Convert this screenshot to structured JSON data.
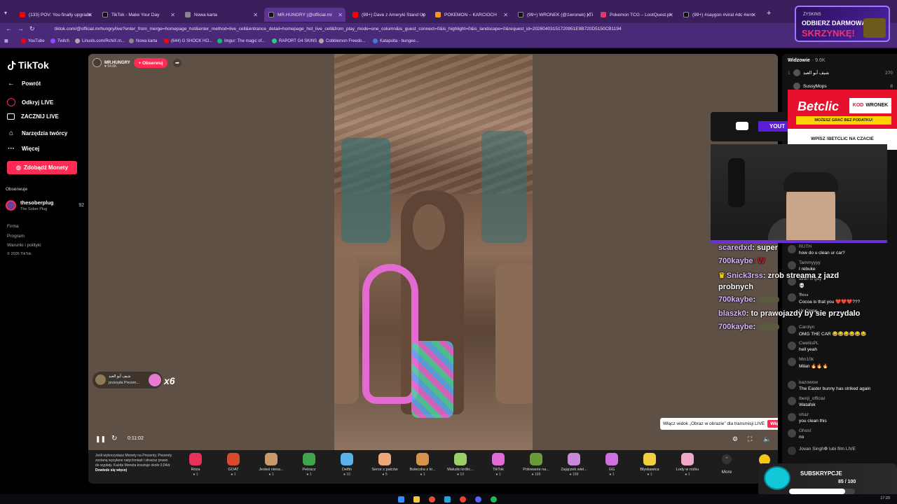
{
  "browser": {
    "tabs": [
      {
        "label": "(133) POV: You finally upgrade",
        "color": "#ff0000"
      },
      {
        "label": "TikTok - Make Your Day",
        "color": "#111111"
      },
      {
        "label": "Nowa karta",
        "color": "#888888"
      },
      {
        "label": "MR.HUNGRY (@official.mr",
        "color": "#111111"
      },
      {
        "label": "(99+) Dave z Ameryki Stand Up",
        "color": "#ff0000"
      },
      {
        "label": "POKEMON – KARCIOCH",
        "color": "#f39c12"
      },
      {
        "label": "(99+) WRONEK (@1wronek) | Ti",
        "color": "#111111"
      },
      {
        "label": "Pokemon TCG – LootQuest.pl",
        "color": "#e23b6b"
      },
      {
        "label": "(99+) #saygon #viral #dc #wro",
        "color": "#111111"
      }
    ],
    "url": "tiktok.com/@official.mrhungry/live?enter_from_merge=homepage_hot&enter_method=live_cell&entrance_detail=homepage_hot_live_cell&from_play_mode=one_column&is_guest_connect=0&is_highlight=0&is_landscape=0&request_id=20260403151720951E9B720D5150CB1194",
    "bookmarks": [
      "YouTube",
      "Twitch",
      "Linuxls.com/RchiX.m...",
      "Nowa karta",
      "(644) G SHOCK HO...",
      "Imgur: The magic of...",
      "RAPORT G4 SKINS",
      "Cobblemon Freedo...",
      "Katapulta - bungee..."
    ]
  },
  "sidebar": {
    "logo": "TikTok",
    "back": "Powrót",
    "nav": [
      "Odkryj LIVE",
      "ZACZNIJ LIVE",
      "Narzędzia twórcy",
      "Więcej"
    ],
    "coins_button": "Zdobądź Monety",
    "following_heading": "Obserwuje",
    "followed": {
      "name": "thesoberplug",
      "sub": "The Sober Plug",
      "count": "92"
    },
    "footer": [
      "Firma",
      "Program",
      "Warunki i polityki",
      "© 2026 TikTok"
    ]
  },
  "stream": {
    "host_name": "MR.HUNGRY",
    "host_likes": "♥ 54.6K",
    "follow_label": "+ Obserwuj",
    "gift_sender": "شيف أبو العبد",
    "gift_sent": "przesyła Prezen...",
    "gift_multiplier": "x6",
    "time": "0:11:02",
    "pip_tip": "Włącz widok „Obraz w obrazie” dla transmisji LIVE",
    "pip_on": "Włącz"
  },
  "giftbar": {
    "note": "Jeśli wykorzystasz Monety na Prezenty, Prezenty zostaną wysyłane natychmiast i stracisz prawo do wypłaty. Każda Moneta kosztuje około 0,04zł.",
    "note_link": "Dowiedz się więcej",
    "gifts": [
      {
        "name": "Róża",
        "price": "1",
        "color": "#e8325a"
      },
      {
        "name": "GOAT",
        "price": "1",
        "color": "#d84a2f"
      },
      {
        "name": "Jesteś niesa...",
        "price": "1",
        "color": "#c89a6a"
      },
      {
        "name": "Pełzacz",
        "price": "1",
        "color": "#3fa34d"
      },
      {
        "name": "Delfin",
        "price": "10",
        "color": "#5ab3e8"
      },
      {
        "name": "Serce z palców",
        "price": "5",
        "color": "#f0a878"
      },
      {
        "name": "Bułeczka z kr...",
        "price": "1",
        "color": "#d9924a"
      },
      {
        "name": "Maluśki królic...",
        "price": "10",
        "color": "#9ad06a"
      },
      {
        "name": "TikTok",
        "price": "1",
        "color": "#e06ad8"
      },
      {
        "name": "Polowanie na...",
        "price": "199",
        "color": "#6a9a3a"
      },
      {
        "name": "Zajączek wiel...",
        "price": "199",
        "color": "#c88ad8"
      },
      {
        "name": "GG",
        "price": "1",
        "color": "#d070e0"
      },
      {
        "name": "Błyskawica",
        "price": "1",
        "color": "#f0d040"
      },
      {
        "name": "Lody w rożku",
        "price": "1",
        "color": "#f0a8c8"
      }
    ],
    "more": "More",
    "extra_label": "Rec"
  },
  "chat": {
    "viewers_label": "Widzowie",
    "viewers_count": "· 9.6K",
    "top_viewers": [
      {
        "rank": "1",
        "name": "شيف أبو العبد",
        "score": "270"
      },
      {
        "rank": "",
        "name": "SussyMops",
        "score": "8"
      }
    ],
    "messages": [
      {
        "name": "RUTH",
        "text": "how do u clean ur car?"
      },
      {
        "name": "Tammyyyy",
        "text": "I rebuke"
      },
      {
        "name": "allah is gay",
        "text": "💀"
      },
      {
        "name": "𝕭𝖔𝖘𝖘",
        "text": "Cocoa is that you ❤️❤️❤️???"
      },
      {
        "name": "",
        "text": "Ur Crone"
      },
      {
        "name": "Carolyn",
        "text": "OMG THE CAR 😂😂😂😂😂😂"
      },
      {
        "name": "CwellisPL",
        "text": "hell yeah"
      },
      {
        "name": "Min10k",
        "text": "Milan 🔥🔥🔥"
      },
      {
        "name": "bazowow",
        "text": "The Easter bunny has striked again"
      },
      {
        "name": "lbenji_official",
        "text": "Watafok"
      },
      {
        "name": "ohaz",
        "text": "you clean this"
      },
      {
        "name": "Ghost",
        "text": "no"
      },
      {
        "name": "",
        "text": "Jovan Singh❁ lubi film LIVE"
      }
    ]
  },
  "overlay": {
    "stream_chat": [
      {
        "name": "scaredxd",
        "msg": ": super",
        "color": "#c58cff"
      },
      {
        "name": "700kaybe",
        "msg": ": W",
        "color": "#d9b8ff"
      },
      {
        "name": "Snick3rss",
        "msg": ": zrob streama z jazd",
        "color": "#c58cff"
      },
      {
        "name": "",
        "msg": "probnych",
        "color": "#ffffff"
      },
      {
        "name": "700kaybe",
        "msg": ":",
        "color": "#d9b8ff"
      },
      {
        "name": "blaszk0",
        "msg": ": to prawojazdy by sie przydalo",
        "color": "#c58cff"
      },
      {
        "name": "700kaybe",
        "msg": ":",
        "color": "#d9b8ff"
      }
    ],
    "youtube_label": "YOUT",
    "betclic": {
      "brand": "Betclic",
      "code_label": "KOD",
      "code": "WRONEK",
      "strip": "MOŻESZ GRAĆ BEZ PODATKU!",
      "bottom": "WPISZ !BETCLIC NA CZACIE"
    },
    "skrzynka": {
      "small": "ZYSKINS",
      "line1": "ODBIERZ DARMOWĄ",
      "line2": "SKRZYNKĘ!"
    },
    "subs": {
      "label": "SUBSKRYPCJE",
      "count": "85 / 100",
      "progress": 0.85
    }
  },
  "taskbar": {
    "clock": "17:20"
  }
}
